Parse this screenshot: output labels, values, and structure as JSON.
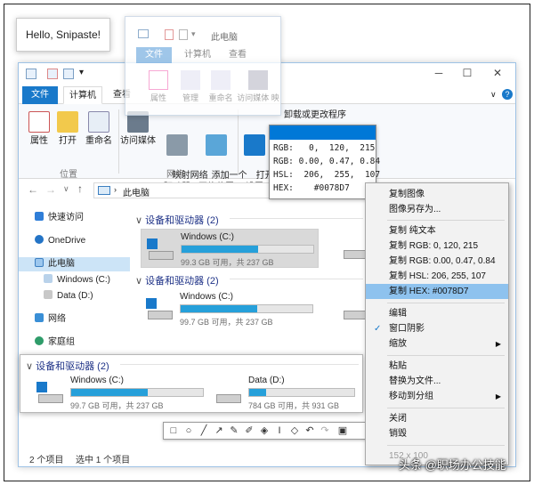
{
  "hello_note": "Hello, Snipaste!",
  "explorer": {
    "title_path": "此电脑",
    "tabs": [
      "文件",
      "计算机",
      "查看"
    ],
    "ribbon_buttons": {
      "properties": "属性",
      "open": "打开",
      "rename": "重命名",
      "access_media": "访问媒体",
      "map_drive": "映射网络\n驱动器",
      "add_location": "添加一个\n网络位置",
      "open_settings": "打开\n设置",
      "uninstall": "卸载或更改程序"
    },
    "group_labels": [
      "位置",
      "网络"
    ],
    "address": "此电脑",
    "nav": {
      "quick_access": "快速访问",
      "onedrive": "OneDrive",
      "this_pc": "此电脑",
      "windows_c": "Windows (C:)",
      "data_d": "Data (D:)",
      "network": "网络",
      "homegroup": "家庭组"
    },
    "section_title": "设备和驱动器 (2)",
    "drives": [
      {
        "name": "Windows (C:)",
        "info": "99.3 GB 可用，共 237 GB",
        "used": 0.58
      },
      {
        "name": "D",
        "info": "",
        "used": 0.2
      }
    ],
    "drives2": [
      {
        "name": "Windows (C:)",
        "info": "99.7 GB 可用，共 237 GB",
        "used": 0.58
      },
      {
        "name": "D",
        "info": "",
        "used": 0.2
      }
    ],
    "status_left": "2 个项目",
    "status_sel": "选中 1 个项目"
  },
  "ghost_window": {
    "title": "此电脑",
    "tabs": [
      "文件",
      "计算机",
      "查看"
    ],
    "buttons": [
      "属性",
      "管理",
      "重命名",
      "访问媒体 映"
    ]
  },
  "pinned": {
    "section_title": "设备和驱动器 (2)",
    "drives": [
      {
        "name": "Windows (C:)",
        "info": "99.7 GB 可用，共 237 GB",
        "used": 0.58
      },
      {
        "name": "Data (D:)",
        "info": "784 GB 可用，共 931 GB",
        "used": 0.16
      }
    ]
  },
  "color_info": {
    "swatch": "#0078D7",
    "rgb": "RGB:   0,  120,  215",
    "rgbf": "RGB: 0.00, 0.47, 0.84",
    "hsl": "HSL:  206,  255,  107",
    "hex": "HEX:    #0078D7"
  },
  "context_menu": {
    "copy_image": "复制图像",
    "save_as": "图像另存为...",
    "copy_text": "复制 纯文本",
    "copy_rgb": "复制 RGB: 0, 120, 215",
    "copy_rgbf": "复制 RGB: 0.00, 0.47, 0.84",
    "copy_hsl": "复制 HSL: 206, 255, 107",
    "copy_hex": "复制 HEX: #0078D7",
    "edit": "编辑",
    "shadow": "窗口阴影",
    "zoom": "缩放",
    "paste": "粘贴",
    "replace": "替换为文件...",
    "move_group": "移动到分组",
    "close": "关闭",
    "destroy": "销毁",
    "size": "152 x 100"
  },
  "watermark": "头条 @职场办公技能",
  "colors": {
    "accent": "#1979ca",
    "swatch": "#0078D7",
    "highlight": "#8ec2ee"
  }
}
